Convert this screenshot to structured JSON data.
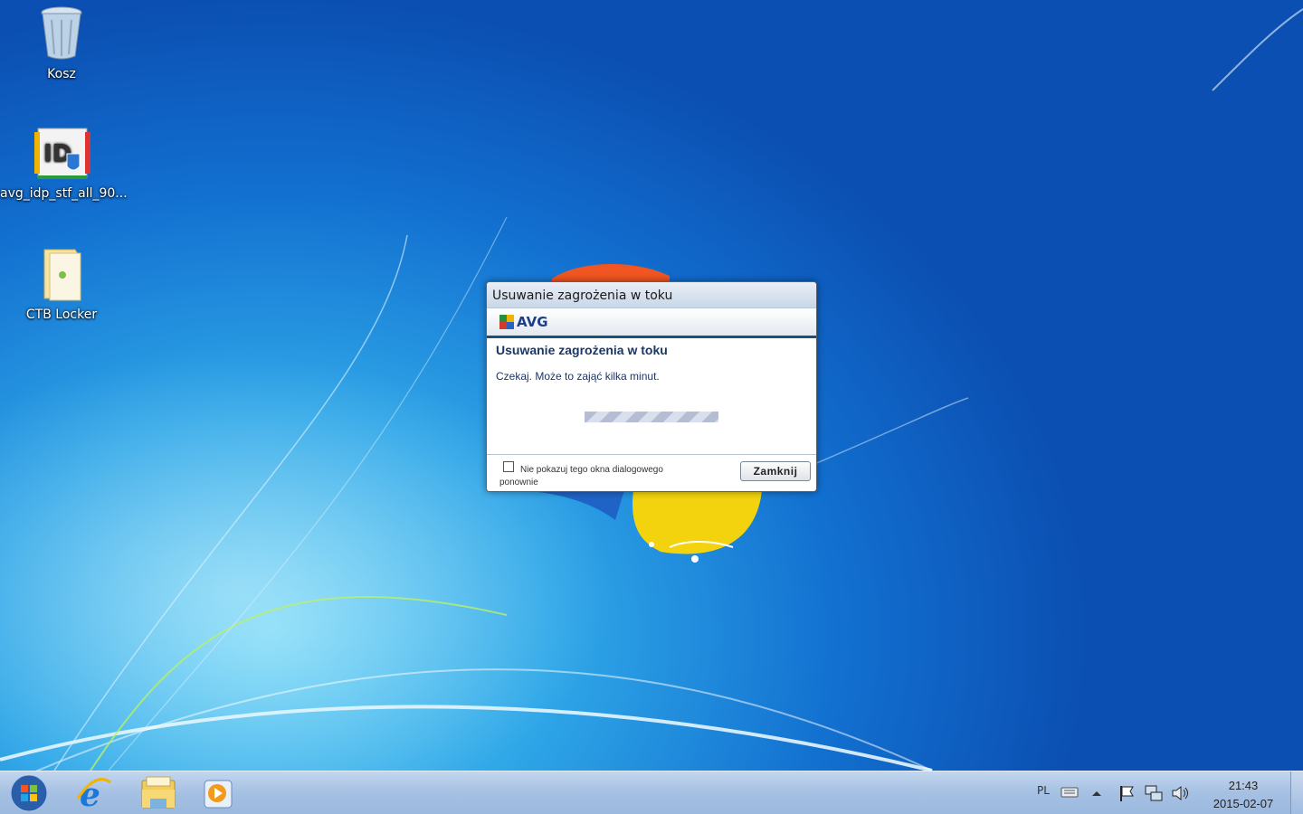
{
  "desktop": {
    "icons": [
      {
        "label": "Kosz",
        "icon": "recycle-bin-icon"
      },
      {
        "label": "avg_idp_stf_all_90...",
        "icon": "installer-icon"
      },
      {
        "label": "CTB Locker",
        "icon": "folder-icon"
      }
    ]
  },
  "dialog": {
    "title": "Usuwanie zagrożenia w toku",
    "brand": "AVG",
    "heading": "Usuwanie zagrożenia w toku",
    "message": "Czekaj. Może to zająć kilka minut.",
    "checkbox_label": "Nie pokazuj tego okna dialogowego ponownie",
    "checkbox_checked": false,
    "close_button": "Zamknij"
  },
  "taskbar": {
    "pinned": [
      "start-orb-icon",
      "internet-explorer-icon",
      "windows-explorer-icon",
      "media-player-icon"
    ],
    "tray": {
      "language": "PL",
      "time": "21:43",
      "date": "2015-02-07"
    }
  },
  "colors": {
    "dialog_heading": "#1b3766",
    "brand_blue": "#1e3f88",
    "taskbar": "#a5c0e3"
  }
}
